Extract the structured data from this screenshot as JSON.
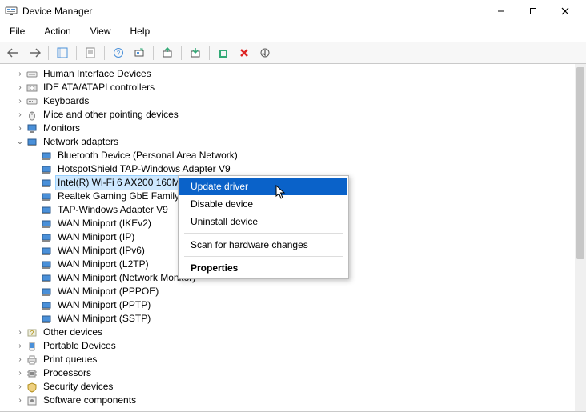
{
  "window": {
    "title": "Device Manager"
  },
  "menu": {
    "file": "File",
    "action": "Action",
    "view": "View",
    "help": "Help"
  },
  "tree": {
    "hid": "Human Interface Devices",
    "ide": "IDE ATA/ATAPI controllers",
    "keyboards": "Keyboards",
    "mice": "Mice and other pointing devices",
    "monitors": "Monitors",
    "network": "Network adapters",
    "net_items": {
      "bt": "Bluetooth Device (Personal Area Network)",
      "hotspot": "HotspotShield TAP-Windows Adapter V9",
      "intel": "Intel(R) Wi-Fi 6 AX200 160M",
      "realtek": "Realtek Gaming GbE Family",
      "tap": "TAP-Windows Adapter V9",
      "ikev2": "WAN Miniport (IKEv2)",
      "ip": "WAN Miniport (IP)",
      "ipv6": "WAN Miniport (IPv6)",
      "l2tp": "WAN Miniport (L2TP)",
      "netmon": "WAN Miniport (Network Monitor)",
      "pppoe": "WAN Miniport (PPPOE)",
      "pptp": "WAN Miniport (PPTP)",
      "sstp": "WAN Miniport (SSTP)"
    },
    "other": "Other devices",
    "portable": "Portable Devices",
    "printq": "Print queues",
    "processors": "Processors",
    "security": "Security devices",
    "software": "Software components"
  },
  "context_menu": {
    "update": "Update driver",
    "disable": "Disable device",
    "uninstall": "Uninstall device",
    "scan": "Scan for hardware changes",
    "properties": "Properties"
  }
}
